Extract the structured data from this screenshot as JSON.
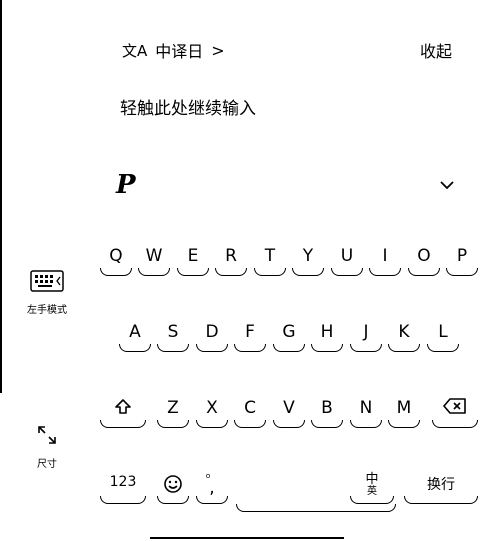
{
  "header": {
    "translate_label": "中译日",
    "translate_arrow": ">",
    "collapse_label": "收起"
  },
  "input_hint": "轻触此处继续输入",
  "toolbar": {
    "logo_glyph": "P"
  },
  "side_tools": {
    "keyboard_mode_label": "左手模式",
    "size_label": "尺寸"
  },
  "keyboard": {
    "row1": [
      "Q",
      "W",
      "E",
      "R",
      "T",
      "Y",
      "U",
      "I",
      "O",
      "P"
    ],
    "row2": [
      "A",
      "S",
      "D",
      "F",
      "G",
      "H",
      "J",
      "K",
      "L"
    ],
    "row3": [
      "Z",
      "X",
      "C",
      "V",
      "B",
      "N",
      "M"
    ],
    "numbers_key": "123",
    "punct_top": "。",
    "punct_bottom": ",",
    "lang_key": "中",
    "lang_sub": "英",
    "enter_key": "换行"
  }
}
